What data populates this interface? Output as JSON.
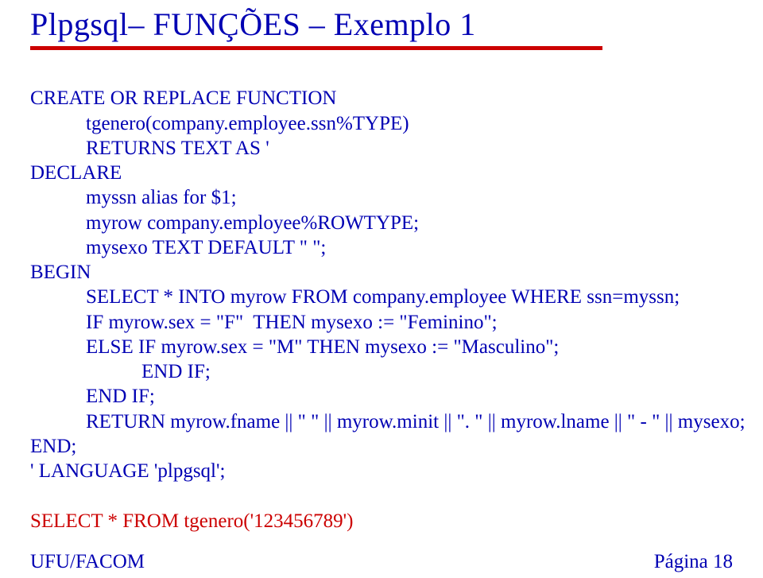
{
  "slide": {
    "title": "Plpgsql– FUNÇÕES – Exemplo 1",
    "code": {
      "l1": "CREATE OR REPLACE FUNCTION",
      "l2": "tgenero(company.employee.ssn%TYPE)",
      "l3": "RETURNS TEXT AS '",
      "l4": "DECLARE",
      "l5": "myssn alias for $1;",
      "l6": "myrow company.employee%ROWTYPE;",
      "l7": "mysexo TEXT DEFAULT \" \";",
      "l8": "BEGIN",
      "l9": "SELECT * INTO myrow FROM company.employee WHERE ssn=myssn;",
      "l10": "IF myrow.sex = \"F\"  THEN mysexo := \"Feminino\";",
      "l11": "ELSE IF myrow.sex = \"M\" THEN mysexo := \"Masculino\";",
      "l12": "END IF;",
      "l13": "END IF;",
      "l14": "RETURN myrow.fname || \" \" || myrow.minit || \". \" || myrow.lname || \" - \" || mysexo;",
      "l15": "END;",
      "l16": "' LANGUAGE 'plpgsql';",
      "l17": "SELECT * FROM tgenero('123456789')"
    },
    "footer": {
      "left": "UFU/FACOM",
      "right": "Página 18"
    }
  }
}
